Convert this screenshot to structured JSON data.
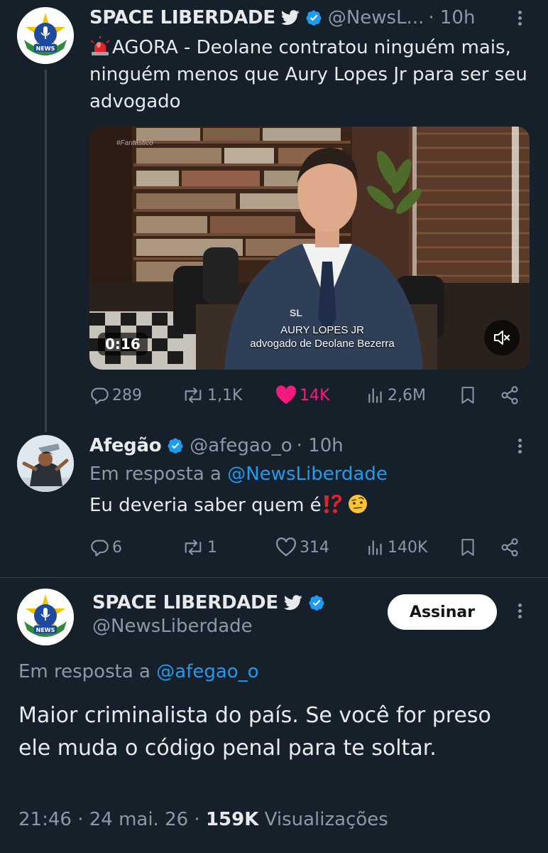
{
  "tweet1": {
    "author_name": "SPACE LIBERDADE",
    "handle": "@NewsL...",
    "time": "· 10h",
    "text": "AGORA - Deolane contratou ninguém mais, ninguém menos que Aury Lopes Jr para ser seu advogado",
    "video": {
      "duration": "0:16",
      "watermark": "#Fantástico",
      "logo_text": "SL",
      "caption_name": "AURY LOPES JR",
      "caption_role": "advogado de Deolane Bezerra"
    },
    "stats": {
      "replies": "289",
      "reposts": "1,1K",
      "likes": "14K",
      "views": "2,6M"
    }
  },
  "tweet2": {
    "author_name": "Afegão",
    "handle": "@afegao_o",
    "time": "· 10h",
    "reply_prefix": "Em resposta a",
    "reply_to": "@NewsLiberdade",
    "text": "Eu deveria saber quem é",
    "stats": {
      "replies": "6",
      "reposts": "1",
      "likes": "314",
      "views": "140K"
    }
  },
  "main_tweet": {
    "author_name": "SPACE LIBERDADE",
    "handle": "@NewsLiberdade",
    "follow_label": "Assinar",
    "reply_prefix": "Em resposta a",
    "reply_to": "@afegao_o",
    "text": "Maior criminalista do país. Se você for preso ele muda o código penal para te soltar.",
    "time": "21:46 · 24 mai. 26 · ",
    "views_count": "159K",
    "views_label": " Visualizações"
  },
  "colors": {
    "background": "#15202b",
    "accent": "#1d9bf0",
    "like": "#f91880",
    "muted": "#8b98a5"
  },
  "icons": [
    "news-logo-icon",
    "twitter-bird-icon",
    "verified-badge-icon",
    "more-icon",
    "siren-icon",
    "reply-icon",
    "repost-icon",
    "like-icon",
    "views-icon",
    "bookmark-icon",
    "share-icon",
    "mute-icon",
    "exclamation-question-icon",
    "raised-eyebrow-emoji-icon"
  ]
}
